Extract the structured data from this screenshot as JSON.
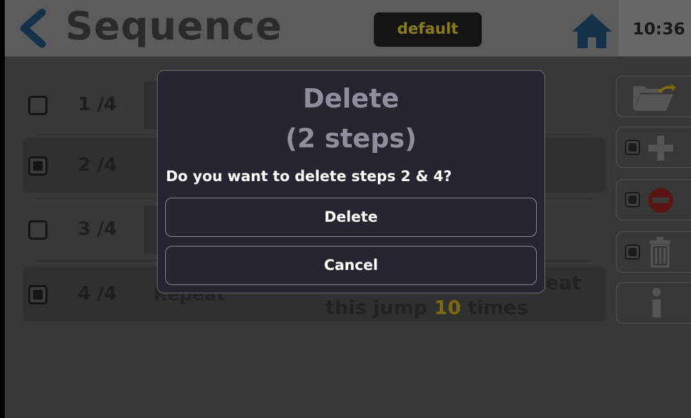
{
  "header": {
    "title": "Sequence",
    "profile": "default",
    "time": "10:36"
  },
  "steps": [
    {
      "num": "1 /4",
      "type": "",
      "desc": "",
      "checked": false
    },
    {
      "num": "2 /4",
      "type": "",
      "desc": "",
      "checked": true
    },
    {
      "num": "3 /4",
      "type": "",
      "desc": "",
      "checked": false
    },
    {
      "num": "4 /4",
      "type": "Repeat",
      "desc_a": "eat",
      "desc_b": "this jump",
      "desc_count": "10",
      "desc_c": "times",
      "checked": true
    }
  ],
  "toolbar": {
    "icons": [
      "folder-open-icon",
      "add-icon",
      "remove-icon",
      "trash-icon",
      "info-icon"
    ]
  },
  "dialog": {
    "title_line1": "Delete",
    "title_line2": "(2 steps)",
    "message": "Do you want to delete steps 2 & 4?",
    "delete_label": "Delete",
    "cancel_label": "Cancel"
  },
  "colors": {
    "back_arrow": "#16324a",
    "home": "#16324a",
    "highlight": "#7a6a10"
  }
}
